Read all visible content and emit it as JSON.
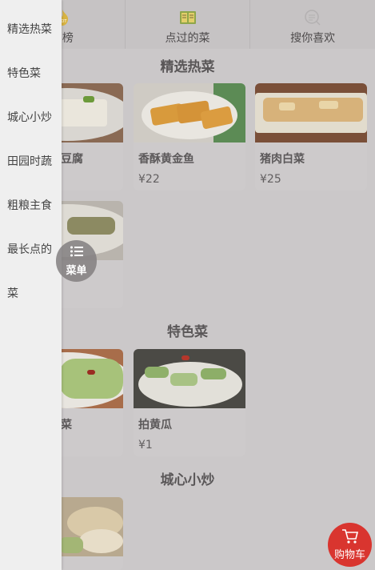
{
  "tabs": [
    {
      "label": "销榜",
      "icon": "hot-icon"
    },
    {
      "label": "点过的菜",
      "icon": "book-icon"
    },
    {
      "label": "搜你喜欢",
      "icon": "search-icon"
    }
  ],
  "sidebar": {
    "items": [
      {
        "label": "精选热菜"
      },
      {
        "label": "特色菜"
      },
      {
        "label": "城心小炒"
      },
      {
        "label": "田园时蔬"
      },
      {
        "label": "粗粮主食"
      },
      {
        "label": "最长点的"
      },
      {
        "label": "菜"
      }
    ]
  },
  "sections": [
    {
      "title": "精选热菜"
    },
    {
      "title": "特色菜"
    },
    {
      "title": "城心小炒"
    }
  ],
  "dishes": {
    "tofu": {
      "name": "豆腐"
    },
    "fish": {
      "name": "香酥黄金鱼",
      "price": "¥22"
    },
    "pork": {
      "name": "猪肉白菜",
      "price": "¥25"
    },
    "cabbage": {
      "name": "菜"
    },
    "cucumber": {
      "name": "拍黄瓜",
      "price": "¥1"
    }
  },
  "menu_button": {
    "label": "菜单"
  },
  "cart_button": {
    "label": "购物车"
  },
  "colors": {
    "cart": "#d9352f",
    "sidebar": "#efefef",
    "overlay_bg": "#cbc8c9"
  }
}
